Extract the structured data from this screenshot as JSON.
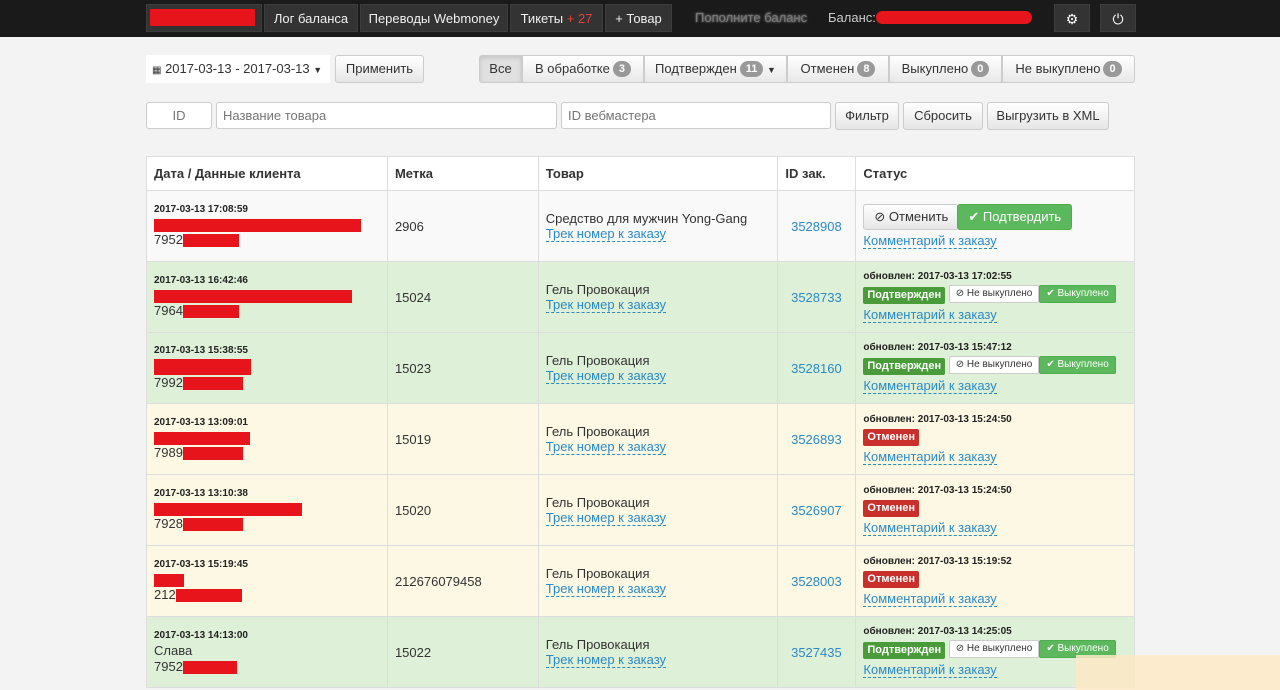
{
  "topbar": {
    "balance_log": "Лог баланса",
    "webmoney": "Переводы Webmoney",
    "tickets_label": "Тикеты",
    "tickets_count": "+ 27",
    "add_product": "+ Товар",
    "topup": "Пополните баланс",
    "balance_label": "Баланс:",
    "settings_icon": "gear-icon",
    "power_icon": "power-icon"
  },
  "filters": {
    "date_range": "2017-03-13 - 2017-03-13",
    "apply": "Применить",
    "tabs": [
      {
        "label": "Все",
        "count": ""
      },
      {
        "label": "В обработке",
        "count": "3"
      },
      {
        "label": "Подтвержден",
        "count": "11"
      },
      {
        "label": "Отменен",
        "count": "8"
      },
      {
        "label": "Выкуплено",
        "count": "0"
      },
      {
        "label": "Не выкуплено",
        "count": "0"
      }
    ],
    "id_placeholder": "ID",
    "product_placeholder": "Название товара",
    "webmaster_placeholder": "ID вебмастера",
    "filter_btn": "Фильтр",
    "reset_btn": "Сбросить",
    "export_btn": "Выгрузить в XML"
  },
  "table": {
    "headers": [
      "Дата / Данные клиента",
      "Метка",
      "Товар",
      "ID зак.",
      "Статус"
    ],
    "track_link": "Трек номер к заказу",
    "comment_link": "Комментарий к заказу",
    "cancel_btn": "Отменить",
    "confirm_btn": "Подтвердить",
    "not_bought": "Не выкуплено",
    "bought": "Выкуплено",
    "label_confirmed": "Подтвержден",
    "label_cancelled": "Отменен",
    "rows": [
      {
        "date": "2017-03-13 17:08:59",
        "client": "7952",
        "mark": "2906",
        "product": "Средство для мужчин Yong-Gang",
        "order_id": "3528908",
        "status": "new",
        "updated": ""
      },
      {
        "date": "2017-03-13 16:42:46",
        "client": "7964",
        "mark": "15024",
        "product": "Гель Провокация",
        "order_id": "3528733",
        "status": "confirmed",
        "updated": "обновлен: 2017-03-13 17:02:55"
      },
      {
        "date": "2017-03-13 15:38:55",
        "client": "7992",
        "mark": "15023",
        "product": "Гель Провокация",
        "order_id": "3528160",
        "status": "confirmed",
        "updated": "обновлен: 2017-03-13 15:47:12"
      },
      {
        "date": "2017-03-13 13:09:01",
        "client": "7989",
        "mark": "15019",
        "product": "Гель Провокация",
        "order_id": "3526893",
        "status": "cancelled",
        "updated": "обновлен: 2017-03-13 15:24:50"
      },
      {
        "date": "2017-03-13 13:10:38",
        "client": "7928",
        "mark": "15020",
        "product": "Гель Провокация",
        "order_id": "3526907",
        "status": "cancelled",
        "updated": "обновлен: 2017-03-13 15:24:50"
      },
      {
        "date": "2017-03-13 15:19:45",
        "client": "212",
        "mark": "212676079458",
        "product": "Гель Провокация",
        "order_id": "3528003",
        "status": "cancelled",
        "updated": "обновлен: 2017-03-13 15:19:52"
      },
      {
        "date": "2017-03-13 14:13:00",
        "client_name": "Слава",
        "client": "7952",
        "mark": "15022",
        "product": "Гель Провокация",
        "order_id": "3527435",
        "status": "confirmed",
        "updated": "обновлен: 2017-03-13 14:25:05"
      }
    ]
  }
}
